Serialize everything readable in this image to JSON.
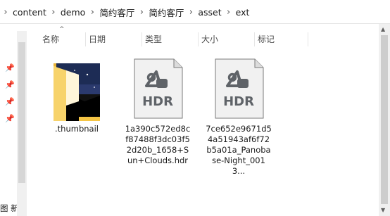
{
  "breadcrumb": {
    "items": [
      "content",
      "demo",
      "简约客厅",
      "简约客厅",
      "asset",
      "ext"
    ],
    "separator": "›"
  },
  "nav_pane": {
    "partial_label": "图 新"
  },
  "columns": {
    "name": "名称",
    "date": "日期",
    "type": "类型",
    "size": "大小",
    "tags": "标记"
  },
  "files": [
    {
      "label": ".thumbnail",
      "kind": "folder",
      "icon": "folder-with-image-icon"
    },
    {
      "label": "1a390c572ed8cf87488f3dc03f52d20b_1658+Sun+Clouds.hdr",
      "kind": "hdr",
      "icon": "hdr-file-icon",
      "badge": "HDR"
    },
    {
      "label": "7ce652e9671d54a51943af6f72b5a01a_Panobase-Night_0013...",
      "kind": "hdr",
      "icon": "hdr-file-icon",
      "badge": "HDR"
    }
  ],
  "colors": {
    "folder": "#f5c545",
    "hdr_icon": "#5f6368",
    "hdr_bg": "#f1f1f1"
  }
}
